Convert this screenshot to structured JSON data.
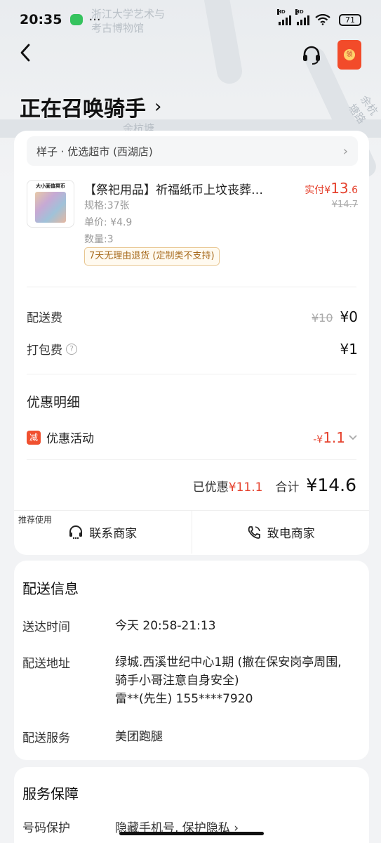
{
  "status_bar": {
    "time": "20:35",
    "dots": "···",
    "battery": "71"
  },
  "map": {
    "label_top": "浙江大学艺术与\n考古博物馆",
    "label_road_1": "余杭塘路",
    "label_road_2": "余杭塘"
  },
  "header": {
    "title": "正在召唤骑手",
    "title_chevron": "›",
    "back": "‹",
    "redpacket_text": "领"
  },
  "order": {
    "store_name": "样子 · 优选超市 (西湖店)",
    "product": {
      "image_label": "大小面值冥币",
      "name": "【祭祀用品】祈福纸币上坟丧葬…",
      "spec": "规格:37张",
      "unit_price": "单价: ¥4.9",
      "quantity": "数量:3",
      "paid_prefix": "实付¥",
      "paid_int": "13",
      "paid_dec": ".6",
      "original_price": "¥14.7",
      "refund_tag": "7天无理由退货 (定制类不支持)"
    },
    "delivery_fee_label": "配送费",
    "delivery_fee_original": "¥10",
    "delivery_fee": "¥0",
    "packing_fee_label": "打包费",
    "packing_fee": "¥1",
    "discount_section_title": "优惠明细",
    "promo_badge": "减",
    "promo_label": "优惠活动",
    "promo_prefix": "-¥",
    "promo_value": "1.1",
    "saved_label": "已优惠",
    "saved_value": "¥11.1",
    "total_label": "合计",
    "total_value": "¥14.6",
    "recommend_label": "推荐使用",
    "contact_merchant": "联系商家",
    "call_merchant": "致电商家"
  },
  "delivery_info": {
    "title": "配送信息",
    "time_label": "送达时间",
    "time_value": "今天 20:58-21:13",
    "address_label": "配送地址",
    "address_value": "绿城.西溪世纪中心1期 (撤在保安岗亭周围, 骑手小哥注意自身安全)",
    "contact_value": "雷**(先生) 155****7920",
    "service_label": "配送服务",
    "service_value": "美团跑腿"
  },
  "guarantee": {
    "title": "服务保障",
    "number_label": "号码保护",
    "number_value": "隐藏手机号, 保护隐私 ›"
  }
}
